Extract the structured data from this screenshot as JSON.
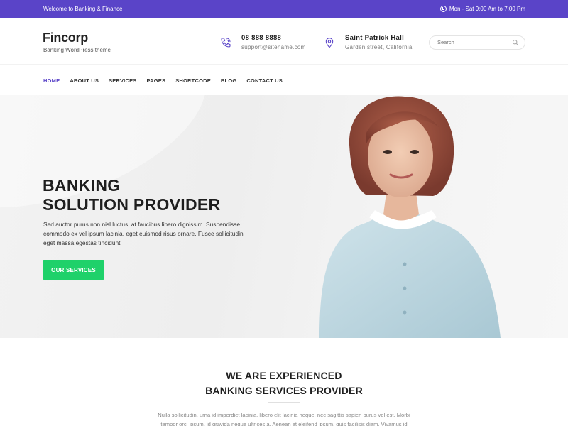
{
  "topbar": {
    "welcome": "Welcome to Banking & Finance",
    "hours": "Mon - Sat 9:00 Am to 7:00 Pm",
    "hours_icon": "clock-icon",
    "background": "#5a44c8"
  },
  "header": {
    "logo_title": "Fincorp",
    "logo_subtitle": "Banking WordPress theme",
    "phone": {
      "icon": "phone-icon",
      "number": "08 888 8888",
      "email": "support@sitename.com"
    },
    "address": {
      "icon": "location-pin-icon",
      "name": "Saint Patrick Hall",
      "street": "Garden street, California"
    },
    "search": {
      "placeholder": "Search",
      "icon": "search-icon"
    }
  },
  "nav": {
    "items": [
      {
        "label": "HOME",
        "active": true
      },
      {
        "label": "ABOUT US",
        "active": false
      },
      {
        "label": "SERVICES",
        "active": false
      },
      {
        "label": "PAGES",
        "active": false
      },
      {
        "label": "SHORTCODE",
        "active": false
      },
      {
        "label": "BLOG",
        "active": false
      },
      {
        "label": "CONTACT US",
        "active": false
      }
    ],
    "active_color": "#5a44c8"
  },
  "hero": {
    "title_line1": "BANKING",
    "title_line2": "SOLUTION PROVIDER",
    "text": "Sed auctor purus non nisl luctus, at faucibus libero dignissim. Suspendisse commodo ex vel ipsum lacinia, eget euismod risus ornare. Fusce sollicitudin eget massa egestas tincidunt",
    "button_label": "OUR SERVICES",
    "button_color": "#1fd16a"
  },
  "about": {
    "title_line1": "WE ARE EXPERIENCED",
    "title_line2": "BANKING SERVICES PROVIDER",
    "text": "Nulla sollicitudin, urna id imperdiet lacinia, libero elit lacinia neque, nec sagittis sapien purus vel est. Morbi tempor orci ipsum, id gravida neque ultrices a. Aenean et eleifend ipsum, quis facilisis diam. Vivamus id"
  }
}
